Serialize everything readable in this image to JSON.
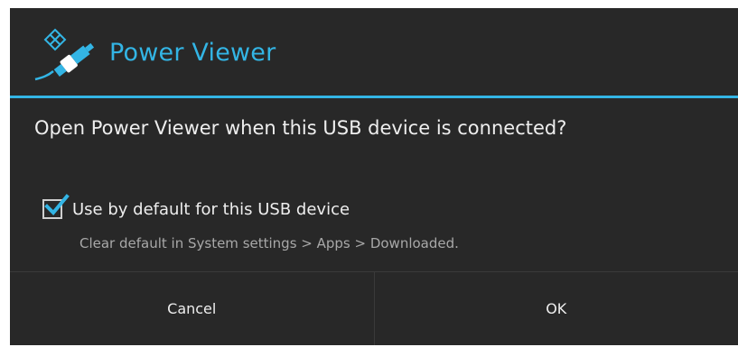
{
  "dialog": {
    "title": "Power Viewer",
    "app_icon": "power-viewer-usb-plug-icon",
    "message": "Open Power Viewer when this USB device is connected?",
    "checkbox": {
      "label": "Use by default for this USB device",
      "checked": true
    },
    "hint": "Clear default in System settings > Apps > Downloaded.",
    "buttons": {
      "cancel": "Cancel",
      "ok": "OK"
    }
  },
  "colors": {
    "accent": "#33b5e5",
    "background": "#282828",
    "text": "#eeeeee",
    "secondary_text": "#a8a8a8"
  }
}
